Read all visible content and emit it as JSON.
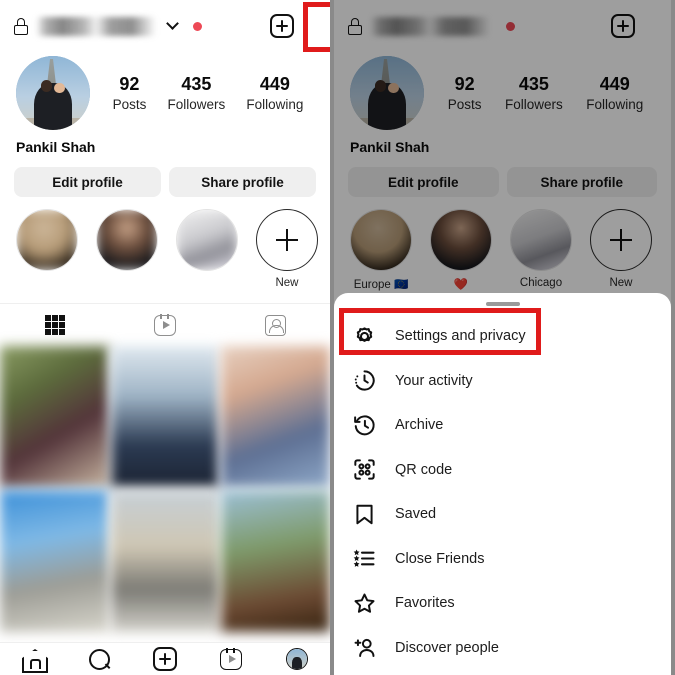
{
  "profile": {
    "username_hidden": true,
    "lock_icon": "lock-icon",
    "chevron_icon": "chevron-down-icon",
    "red_dot_badge": "unread-dot",
    "add_icon": "plus-square-icon",
    "menu_icon": "hamburger-menu-icon",
    "full_name": "Pankil Shah",
    "stats": [
      {
        "num": "92",
        "label": "Posts"
      },
      {
        "num": "435",
        "label": "Followers"
      },
      {
        "num": "449",
        "label": "Following"
      }
    ],
    "actions": [
      {
        "label": "Edit profile"
      },
      {
        "label": "Share profile"
      }
    ],
    "highlights_left": [
      {
        "caption": "",
        "blurred": true
      },
      {
        "caption": "",
        "blurred": true
      },
      {
        "caption": "",
        "blurred": true
      },
      {
        "caption": "New",
        "blurred": false
      }
    ],
    "highlights_right": [
      {
        "caption": "Europe 🇪🇺",
        "blurred": false
      },
      {
        "caption": "❤️",
        "blurred": false
      },
      {
        "caption": "Chicago",
        "blurred": false
      },
      {
        "caption": "New",
        "blurred": false
      }
    ],
    "tabs": [
      {
        "name": "grid-tab",
        "active": true
      },
      {
        "name": "reels-tab",
        "active": false
      },
      {
        "name": "tagged-tab",
        "active": false
      }
    ]
  },
  "bottom_nav": [
    {
      "name": "home"
    },
    {
      "name": "search"
    },
    {
      "name": "create"
    },
    {
      "name": "reels"
    },
    {
      "name": "profile"
    }
  ],
  "sheet": {
    "handle": "drag-handle",
    "items": [
      {
        "label": "Settings and privacy",
        "icon": "gear-icon",
        "highlighted": true
      },
      {
        "label": "Your activity",
        "icon": "activity-clock-icon",
        "highlighted": false
      },
      {
        "label": "Archive",
        "icon": "archive-clock-icon",
        "highlighted": false
      },
      {
        "label": "QR code",
        "icon": "qr-code-icon",
        "highlighted": false
      },
      {
        "label": "Saved",
        "icon": "bookmark-icon",
        "highlighted": false
      },
      {
        "label": "Close Friends",
        "icon": "close-friends-list-icon",
        "highlighted": false
      },
      {
        "label": "Favorites",
        "icon": "star-icon",
        "highlighted": false
      },
      {
        "label": "Discover people",
        "icon": "add-person-icon",
        "highlighted": false
      }
    ]
  },
  "annotations": {
    "highlight_color": "#E01B1B",
    "menu_button_box": "hamburger-menu-highlight",
    "settings_row_box": "settings-and-privacy-highlight"
  }
}
